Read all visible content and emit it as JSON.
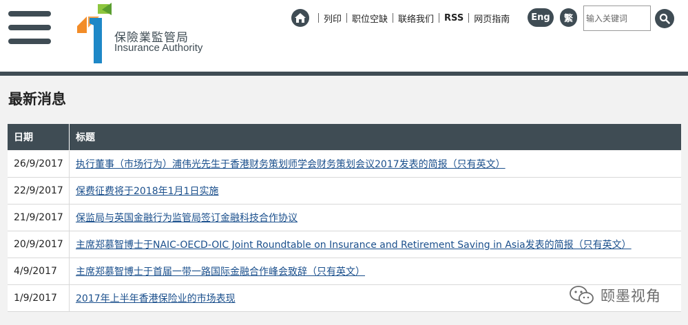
{
  "header": {
    "logo": {
      "name_cn": "保險業監管局",
      "name_en": "Insurance Authority"
    },
    "nav": {
      "print": "列印",
      "jobs": "职位空缺",
      "contact": "联络我们",
      "rss": "RSS",
      "sitemap": "网页指南"
    },
    "lang_eng": "Eng",
    "lang_tc": "繁",
    "search": {
      "placeholder": "输入关键词",
      "value": ""
    }
  },
  "page": {
    "title": "最新消息"
  },
  "table": {
    "headers": {
      "date": "日期",
      "title": "标题"
    },
    "rows": [
      {
        "date": "26/9/2017",
        "title": "执行董事（市场行为）浦伟光先生于香港财务策划师学会财务策划会议2017发表的简报（只有英文）"
      },
      {
        "date": "22/9/2017",
        "title": "保费征费将于2018年1月1日实施"
      },
      {
        "date": "21/9/2017",
        "title": "保监局与英国金融行为监管局签订金融科技合作协议"
      },
      {
        "date": "20/9/2017",
        "title": "主席郑慕智博士于NAIC-OECD-OIC Joint Roundtable on Insurance and Retirement Saving in Asia发表的简报（只有英文）"
      },
      {
        "date": "4/9/2017",
        "title": "主席郑慕智博士于首届一带一路国际金融合作峰会致辞（只有英文）"
      },
      {
        "date": "1/9/2017",
        "title": "2017年上半年香港保险业的市场表现"
      }
    ]
  },
  "watermark": {
    "text": "颐墨视角",
    "icon": "wechat-icon"
  },
  "colors": {
    "header_dark": "#3f4c54",
    "link": "#1a4f8c",
    "logo_orange": "#f28c28",
    "logo_green": "#8dc63f",
    "logo_blue": "#1e88c7"
  }
}
